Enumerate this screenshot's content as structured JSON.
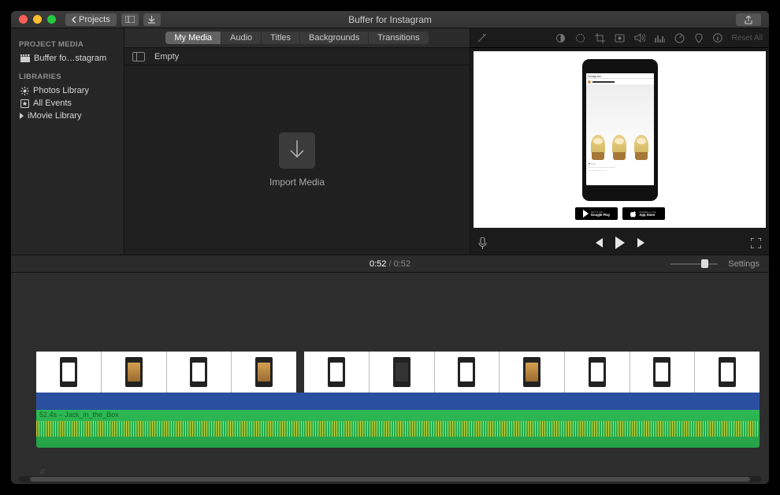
{
  "window": {
    "title": "Buffer for Instagram",
    "back_label": "Projects"
  },
  "traffic": {
    "close": "#ff5f57",
    "minimize": "#ffbd2e",
    "zoom": "#28c940"
  },
  "sidebar": {
    "headers": {
      "media": "PROJECT MEDIA",
      "libraries": "LIBRARIES"
    },
    "project": "Buffer fo…stagram",
    "libs": {
      "photos": "Photos Library",
      "events": "All Events",
      "imovie": "iMovie Library"
    }
  },
  "tabs": {
    "my_media": "My Media",
    "audio": "Audio",
    "titles": "Titles",
    "backgrounds": "Backgrounds",
    "transitions": "Transitions"
  },
  "browser": {
    "list_label": "Empty",
    "import_label": "Import Media"
  },
  "viewer": {
    "reset": "Reset All",
    "phone_app": "Instagram",
    "stores": {
      "google": "Google Play",
      "apple": "App Store",
      "google_pre": "GET IT ON",
      "apple_pre": "Available on the"
    }
  },
  "time": {
    "current": "0:52",
    "duration": "0:52",
    "settings": "Settings"
  },
  "timeline": {
    "audio_clip": "52.4s – Jack_in_the_Box",
    "clips_a": 4,
    "clips_b": 7
  }
}
